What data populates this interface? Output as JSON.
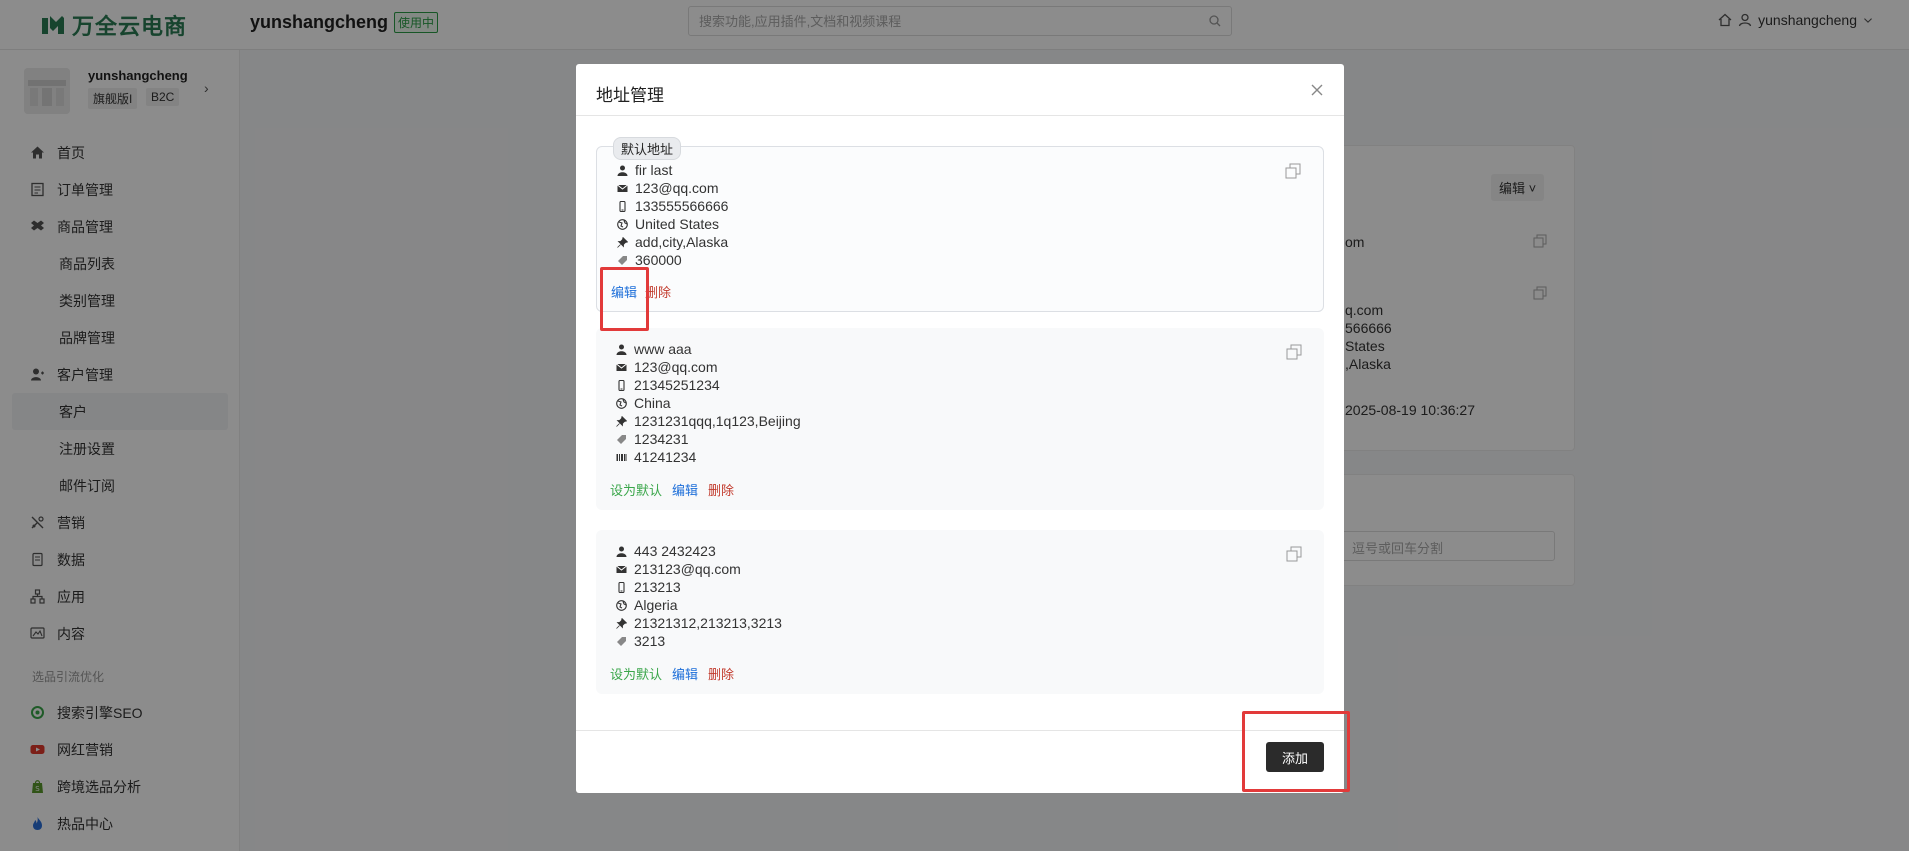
{
  "header": {
    "brand": "万全云电商",
    "shop_name": "yunshangcheng",
    "shop_badge": "使用中",
    "search_placeholder": "搜索功能,应用插件,文档和视频课程",
    "username": "yunshangcheng"
  },
  "sidebar": {
    "store_name": "yunshangcheng",
    "store_tags": [
      "旗舰版I",
      "B2C"
    ],
    "items": [
      {
        "label": "首页",
        "icon": "home-icon"
      },
      {
        "label": "订单管理",
        "icon": "order-icon"
      },
      {
        "label": "商品管理",
        "icon": "box-icon"
      },
      {
        "label": "商品列表",
        "sub": true
      },
      {
        "label": "类别管理",
        "sub": true
      },
      {
        "label": "品牌管理",
        "sub": true
      },
      {
        "label": "客户管理",
        "icon": "customer-icon"
      },
      {
        "label": "客户",
        "sub": true,
        "active": true
      },
      {
        "label": "注册设置",
        "sub": true
      },
      {
        "label": "邮件订阅",
        "sub": true
      },
      {
        "label": "营销",
        "icon": "marketing-icon"
      },
      {
        "label": "数据",
        "icon": "data-icon"
      },
      {
        "label": "应用",
        "icon": "app-icon"
      },
      {
        "label": "内容",
        "icon": "content-icon"
      }
    ],
    "group_title": "选品引流优化",
    "group_items": [
      {
        "label": "搜索引擎SEO",
        "icon": "seo-icon",
        "color": "#3aa64a"
      },
      {
        "label": "网红营销",
        "icon": "youtube-icon",
        "color": "#e23a2c"
      },
      {
        "label": "跨境选品分析",
        "icon": "shopify-icon",
        "color": "#5a9a2d"
      },
      {
        "label": "热品中心",
        "icon": "fire-icon",
        "color": "#2a6fd9"
      }
    ]
  },
  "background": {
    "edit_dropdown": "编辑",
    "lines": [
      "om",
      "q.com",
      "566666",
      "States",
      ",Alaska",
      "2025-08-19 10:36:27"
    ],
    "input_placeholder": "逗号或回车分割"
  },
  "modal": {
    "title": "地址管理",
    "default_tag": "默认地址",
    "addresses": [
      {
        "name": "fir last",
        "email": "123@qq.com",
        "phone": "133555566666",
        "country": "United States",
        "address": "add,city,Alaska",
        "zip": "360000",
        "actions": [
          "编辑",
          "删除"
        ]
      },
      {
        "name": "www aaa",
        "email": "123@qq.com",
        "phone": "21345251234",
        "country": "China",
        "address": "1231231qqq,1q123,Beijing",
        "zip": "1234231",
        "tax": "41241234",
        "actions": [
          "设为默认",
          "编辑",
          "删除"
        ]
      },
      {
        "name": "443 2432423",
        "email": "213123@qq.com",
        "phone": "213213",
        "country": "Algeria",
        "address": "21321312,213213,3213",
        "zip": "3213",
        "actions": [
          "设为默认",
          "编辑",
          "删除"
        ]
      }
    ],
    "add_label": "添加"
  },
  "colors": {
    "brand": "#2a7d55",
    "highlight": "#e23a3a",
    "link_blue": "#1e6fd9",
    "link_red": "#c23a2c",
    "link_green": "#3aa64a"
  }
}
